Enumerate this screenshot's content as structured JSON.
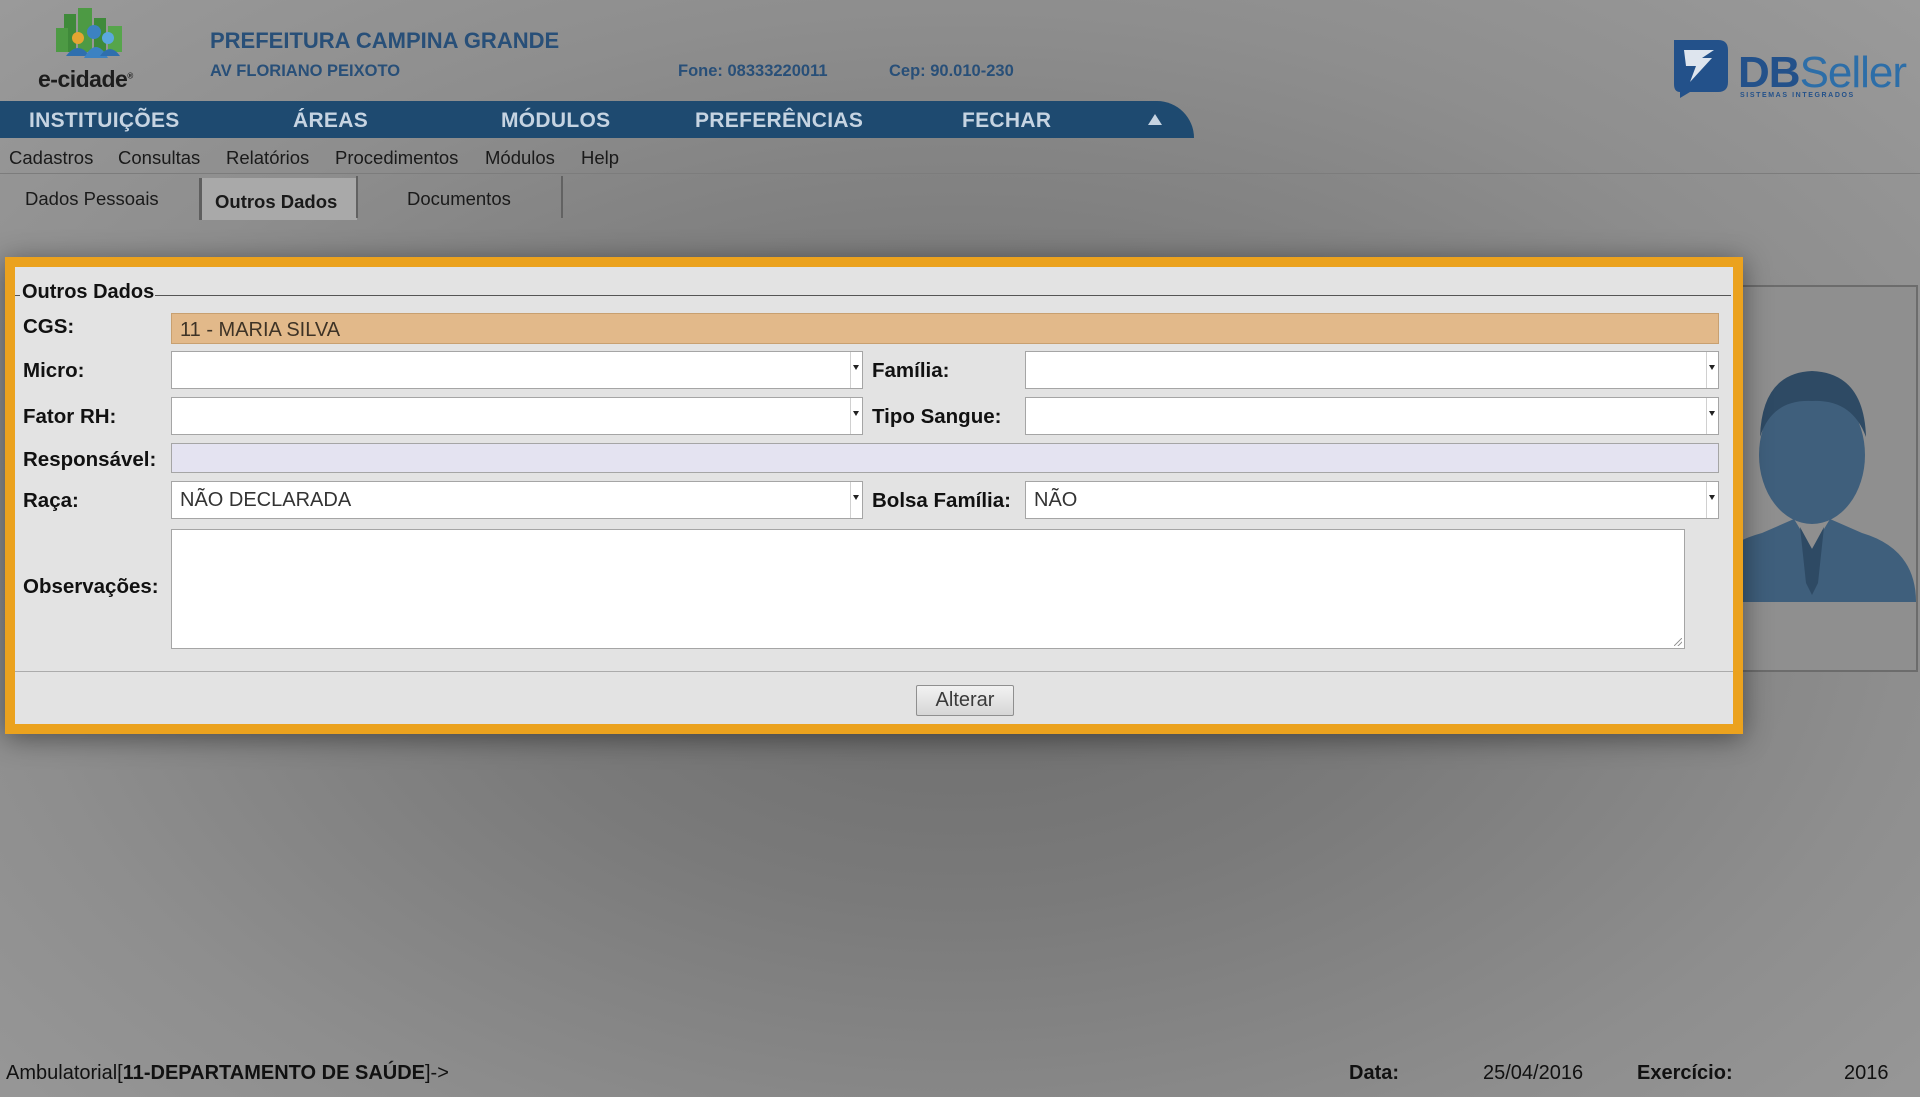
{
  "header": {
    "logo_text": "e-cidade",
    "org_name": "PREFEITURA CAMPINA GRANDE",
    "address": "AV FLORIANO PEIXOTO",
    "phone": "Fone: 08333220011",
    "cep": "Cep: 90.010-230",
    "vendor_logo_bold": "DB",
    "vendor_logo_light": "Seller",
    "vendor_tagline": "SISTEMAS INTEGRADOS"
  },
  "main_nav": [
    "INSTITUIÇÕES",
    "ÁREAS",
    "MÓDULOS",
    "PREFERÊNCIAS",
    "FECHAR"
  ],
  "submenu": [
    "Cadastros",
    "Consultas",
    "Relatórios",
    "Procedimentos",
    "Módulos",
    "Help"
  ],
  "tabs": [
    {
      "label": "Dados Pessoais",
      "active": false
    },
    {
      "label": "Outros Dados",
      "active": true
    },
    {
      "label": "Documentos",
      "active": false
    }
  ],
  "modal": {
    "legend": "Outros Dados",
    "fields": {
      "cgs": {
        "label": "CGS:",
        "value": "11 - MARIA SILVA"
      },
      "micro": {
        "label": "Micro:",
        "value": ""
      },
      "familia": {
        "label": "Família:",
        "value": ""
      },
      "fator_rh": {
        "label": "Fator RH:",
        "value": ""
      },
      "tipo_sangue": {
        "label": "Tipo Sangue:",
        "value": ""
      },
      "responsavel": {
        "label": "Responsável:",
        "value": ""
      },
      "raca": {
        "label": "Raça:",
        "value": "NÃO DECLARADA"
      },
      "bolsa_familia": {
        "label": "Bolsa Família:",
        "value": "NÃO"
      },
      "observacoes": {
        "label": "Observações:",
        "value": ""
      }
    },
    "submit_label": "Alterar"
  },
  "status_bar": {
    "module": "Ambulatorial[",
    "department": "11-DEPARTAMENTO DE SAÚDE",
    "suffix": "]->",
    "date_label": "Data:",
    "date_value": "25/04/2016",
    "year_label": "Exercício:",
    "year_value": "2016"
  },
  "colors": {
    "nav_bg": "#1e4a70",
    "header_text": "#284f78",
    "modal_border": "#eba21e",
    "cgs_bg": "#e2b98a",
    "responsavel_bg": "#e4e3f1"
  },
  "icons": [
    "e-cidade-logo-icon",
    "dbseller-logo-icon",
    "collapse-arrow-icon",
    "avatar-silhouette-icon",
    "chevron-down-icon"
  ]
}
